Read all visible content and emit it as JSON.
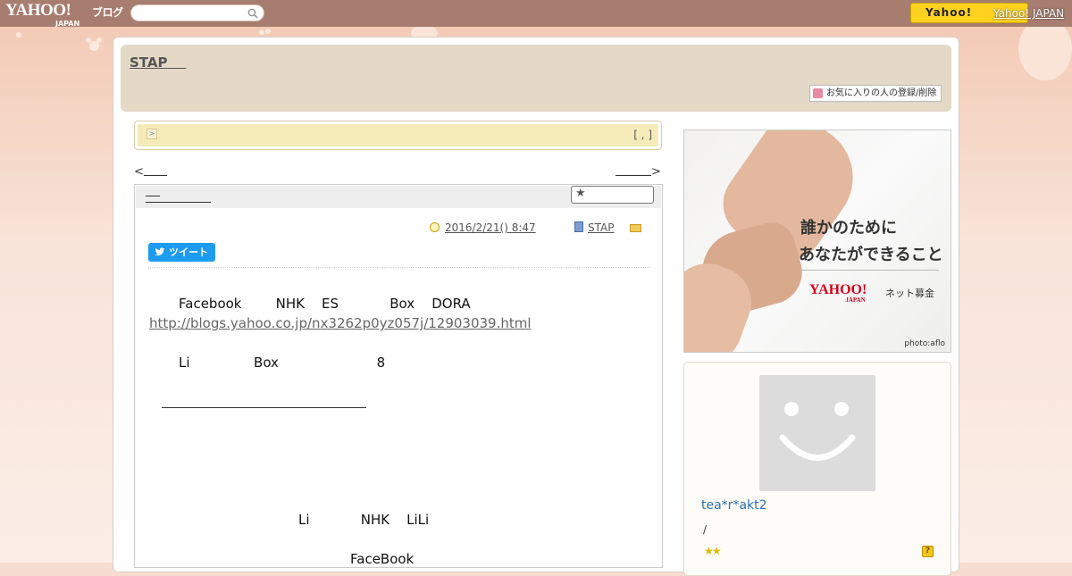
{
  "header": {
    "logo_text": "YAHOO!",
    "logo_sub": "JAPAN",
    "blog_label": "ブログ",
    "search": {
      "placeholder": ""
    },
    "yahoo_button_label": "Yahoo!",
    "yahoo_japan_link": "Yahoo! JAPAN"
  },
  "blog": {
    "title": "STAP",
    "favorites_button": "お気に入りの人の登録/削除"
  },
  "notice": {
    "arrow": ">",
    "brackets": "[ , ]"
  },
  "nav": {
    "prev": "<",
    "next": ">"
  },
  "article": {
    "meta": {
      "datetime": "2016/2/21()  8:47",
      "category": "STAP"
    },
    "tweet_label": "ツイート",
    "lines": [
      "Facebook        NHK    ES            Box    DORA",
      "Li               Box                       8",
      "Li            NHK    LiLi",
      "FaceBook"
    ],
    "link": "http://blogs.yahoo.co.jp/nx3262p0yz057j/12903039.html"
  },
  "sidebar": {
    "ad": {
      "line1": "誰かのために",
      "line2": "あなたができること",
      "brand": "YAHOO!",
      "brand_sub": "JAPAN",
      "tag": "ネット募金",
      "credit": "photo:aflo"
    },
    "profile": {
      "username": "tea*r*akt2",
      "slash": "/",
      "stars": "★★",
      "help": "?"
    }
  },
  "colors": {
    "topbar": "#a77d6f",
    "title_box": "#e4d8c7",
    "notice": "#f5ebb9",
    "tweet": "#1d9bf0",
    "username": "#2f6fb0"
  }
}
